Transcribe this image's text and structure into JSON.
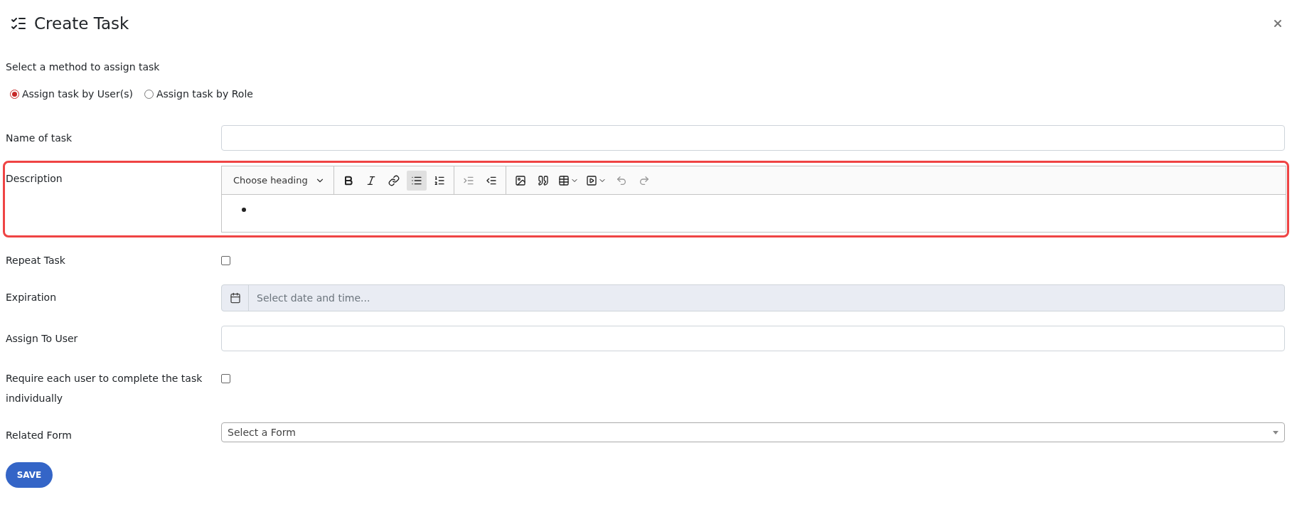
{
  "dialog": {
    "title": "Create Task"
  },
  "method": {
    "label": "Select a method to assign task",
    "options": [
      {
        "label": "Assign task by User(s)",
        "selected": true
      },
      {
        "label": "Assign task by Role",
        "selected": false
      }
    ]
  },
  "fields": [
    {
      "kind": "text",
      "label": "Name of task"
    },
    {
      "kind": "editor",
      "label": "Description",
      "highlighted": true,
      "heading": "Choose heading",
      "bullet_list": true,
      "tool_groups": [
        [
          {
            "kind": "bold",
            "active": false,
            "disabled": false
          },
          {
            "kind": "italic",
            "active": false,
            "disabled": false
          },
          {
            "kind": "link",
            "active": false,
            "disabled": false
          },
          {
            "kind": "bullets",
            "active": true,
            "disabled": false
          },
          {
            "kind": "numbers",
            "active": false,
            "disabled": false
          }
        ],
        [
          {
            "kind": "indent",
            "active": false,
            "disabled": true
          },
          {
            "kind": "outdent",
            "active": false,
            "disabled": false
          }
        ],
        [
          {
            "kind": "image",
            "active": false,
            "disabled": false
          },
          {
            "kind": "quote",
            "active": false,
            "disabled": false
          },
          {
            "kind": "table",
            "active": false,
            "disabled": false
          },
          {
            "kind": "media",
            "active": false,
            "disabled": false
          },
          {
            "kind": "undo",
            "active": false,
            "disabled": true
          },
          {
            "kind": "redo",
            "active": false,
            "disabled": true
          }
        ]
      ]
    },
    {
      "kind": "checkbox",
      "label": "Repeat Task",
      "checked": false
    },
    {
      "kind": "date",
      "label": "Expiration",
      "placeholder": "Select date and time..."
    },
    {
      "kind": "text",
      "label": "Assign To User"
    },
    {
      "kind": "checkbox",
      "label": "Require each user to complete the task individually",
      "checked": false
    },
    {
      "kind": "select",
      "label": "Related Form",
      "value": "Select a Form"
    }
  ],
  "save": "SAVE"
}
